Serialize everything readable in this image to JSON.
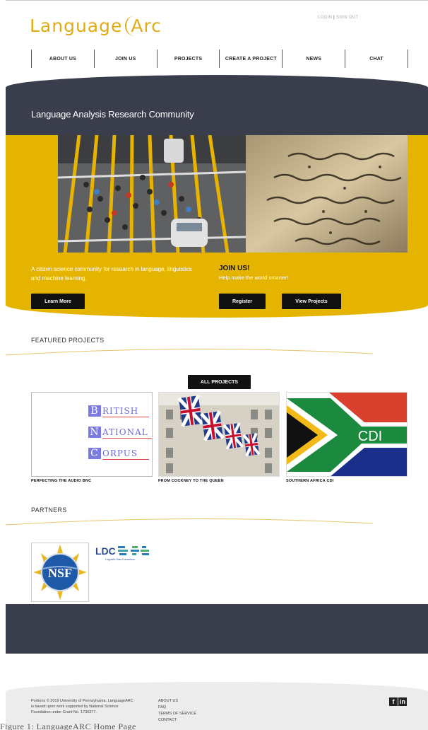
{
  "header": {
    "logo_left": "Language",
    "logo_right": "Arc",
    "login_label": "LOGIN",
    "signout_label": "SIGN OUT"
  },
  "nav": {
    "items": [
      {
        "label": "ABOUT US"
      },
      {
        "label": "JOIN US"
      },
      {
        "label": "PROJECTS"
      },
      {
        "label": "CREATE A PROJECT"
      },
      {
        "label": "NEWS"
      },
      {
        "label": "CHAT"
      }
    ]
  },
  "hero": {
    "title": "Language Analysis Research Community",
    "tagline": "A citizen science community for research in language, linguistics and machine learning.",
    "learn_more": "Learn More",
    "join_title": "JOIN US!",
    "join_sub": "Help make the world smarter!",
    "register": "Register",
    "view_projects": "View Projects"
  },
  "featured": {
    "heading": "FEATURED PROJECTS",
    "all_projects": "ALL PROJECTS",
    "projects": [
      {
        "caption": "PERFECTING THE AUDIO BNC",
        "letters": [
          "B",
          "N",
          "C"
        ],
        "words": [
          "RITISH",
          "ATIONAL",
          "ORPUS"
        ]
      },
      {
        "caption": "FROM COCKNEY TO THE QUEEN"
      },
      {
        "caption": "SOUTHERN AFRICA CDI",
        "flag_text": "CDI"
      }
    ]
  },
  "partners": {
    "heading": "PARTNERS",
    "nsf_label": "NSF",
    "ldc_label": "LDC",
    "ldc_sub": "Linguistic Data Consortium"
  },
  "footer": {
    "left_text": "Portions © 2019 University of Pennsylvania. LanguageARC is based upon work supported by National Science Foundation under Grant No. 1730377.",
    "links": [
      "ABOUT US",
      "FAQ",
      "TERMS OF SERVICE",
      "CONTACT"
    ],
    "social": [
      "f",
      "in"
    ]
  },
  "figure_caption": "Figure 1: LanguageARC Home Page",
  "colors": {
    "gold": "#e5b400",
    "dark": "#3a3e4c",
    "logo": "#e0ac14"
  }
}
